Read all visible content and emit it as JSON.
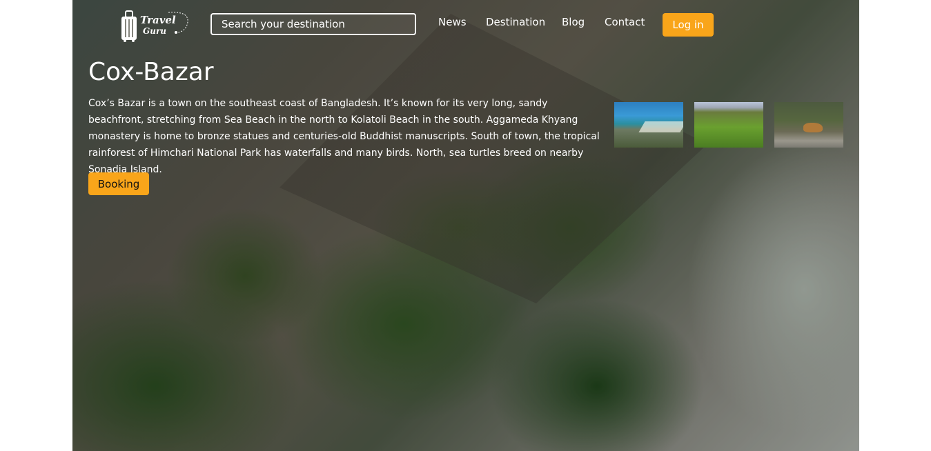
{
  "header": {
    "logo_text_line1": "Travel",
    "logo_text_line2": "Guru",
    "search_placeholder": "Search your destination",
    "nav": [
      {
        "label": "News"
      },
      {
        "label": "Destination"
      },
      {
        "label": "Blog"
      },
      {
        "label": "Contact"
      }
    ],
    "login_label": "Log in"
  },
  "hero": {
    "title": "Cox-Bazar",
    "description": "Cox’s Bazar is a town on the southeast coast of Bangladesh. It’s known for its very long, sandy beachfront, stretching from Sea Beach in the north to Kolatoli Beach in the south. Aggameda Khyang monastery is home to bronze statues and centuries-old Buddhist manuscripts. South of town, the tropical rainforest of Himchari National Park has waterfalls and many birds. North, sea turtles breed on nearby Sonadia Island.",
    "booking_label": "Booking"
  },
  "colors": {
    "accent": "#f9a51a",
    "text": "#ffffff"
  }
}
